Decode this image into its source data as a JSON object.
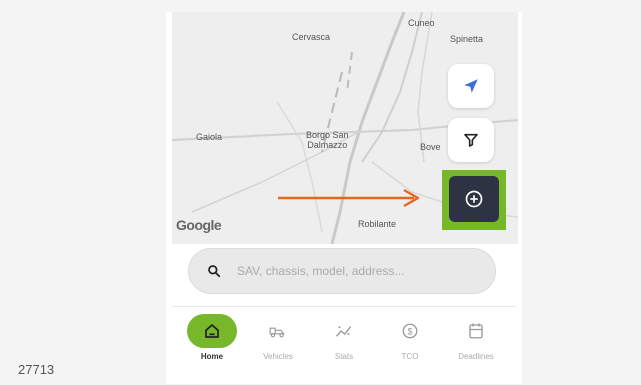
{
  "document_id": "27713",
  "map": {
    "labels": {
      "cuneo": "Cuneo",
      "cervasca": "Cervasca",
      "spinetta": "Spinetta",
      "gaiola": "Gaiola",
      "borgo": "Borgo San\nDalmazzo",
      "boves": "Bove",
      "robilante": "Robilante"
    },
    "google_logo": "Google",
    "icons": {
      "locate": "navigation-arrow-icon",
      "filter": "filter-icon",
      "add": "plus-circle-icon"
    },
    "annotation_arrow_color": "#e4671e",
    "highlight_color": "#76b82a"
  },
  "search": {
    "placeholder": "SAV, chassis, model, address..."
  },
  "nav": {
    "items": [
      {
        "label": "Home",
        "icon": "home-icon",
        "active": true
      },
      {
        "label": "Vehicles",
        "icon": "vehicle-icon",
        "active": false
      },
      {
        "label": "Stats",
        "icon": "stats-icon",
        "active": false
      },
      {
        "label": "TCO",
        "icon": "dollar-circle-icon",
        "active": false
      },
      {
        "label": "Deadlines",
        "icon": "calendar-icon",
        "active": false
      }
    ]
  },
  "colors": {
    "accent_green": "#76b82a",
    "dark_button": "#2d3342",
    "locate_blue": "#3b6fd8"
  }
}
